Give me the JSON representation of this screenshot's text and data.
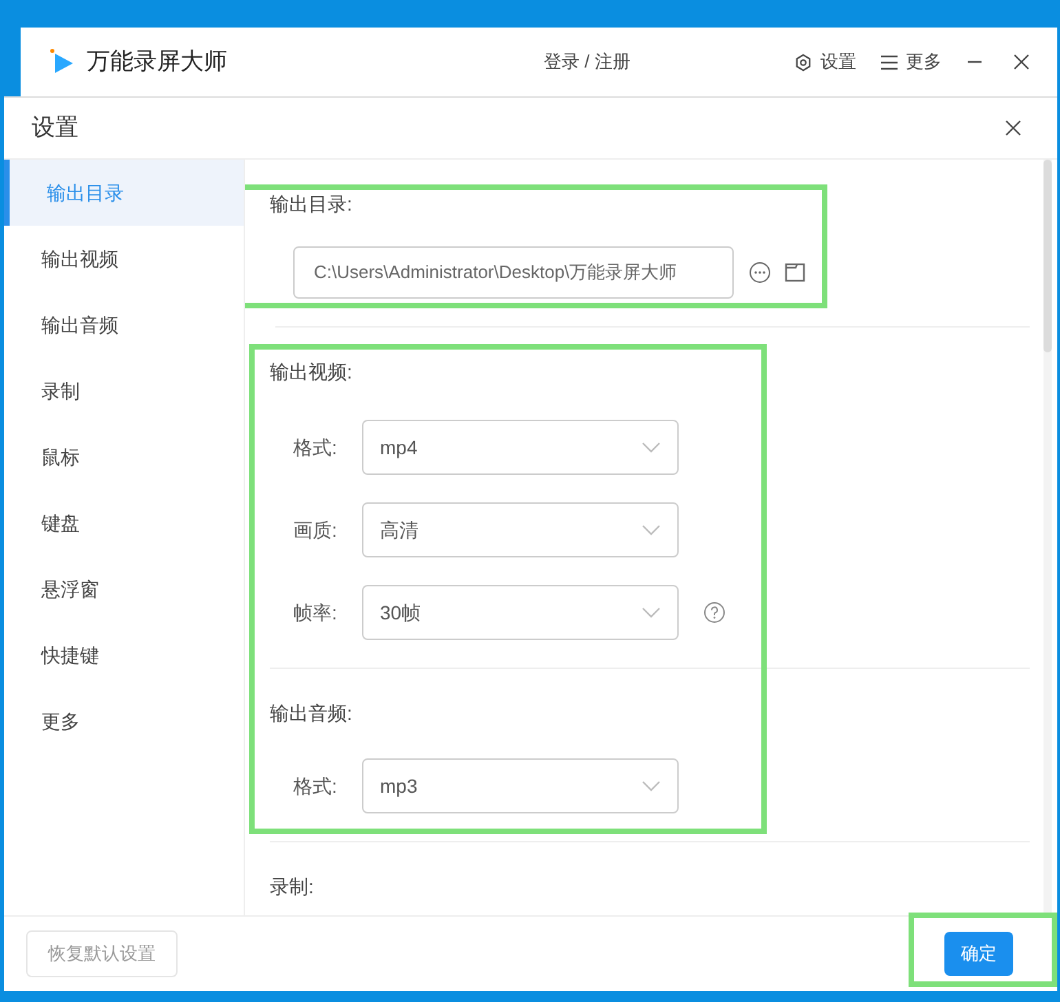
{
  "app": {
    "title": "万能录屏大师",
    "login": "登录 / 注册",
    "settings": "设置",
    "more": "更多"
  },
  "dialog": {
    "title": "设置"
  },
  "sidebar": {
    "items": [
      {
        "label": "输出目录",
        "selected": true
      },
      {
        "label": "输出视频",
        "selected": false
      },
      {
        "label": "输出音频",
        "selected": false
      },
      {
        "label": "录制",
        "selected": false
      },
      {
        "label": "鼠标",
        "selected": false
      },
      {
        "label": "键盘",
        "selected": false
      },
      {
        "label": "悬浮窗",
        "selected": false
      },
      {
        "label": "快捷键",
        "selected": false
      },
      {
        "label": "更多",
        "selected": false
      }
    ]
  },
  "output_dir": {
    "heading": "输出目录:",
    "value": "C:\\Users\\Administrator\\Desktop\\万能录屏大师"
  },
  "output_video": {
    "heading": "输出视频:",
    "fields": [
      {
        "label": "格式:",
        "value": "mp4",
        "help": false
      },
      {
        "label": "画质:",
        "value": "高清",
        "help": false
      },
      {
        "label": "帧率:",
        "value": "30帧",
        "help": true
      }
    ]
  },
  "output_audio": {
    "heading": "输出音频:",
    "fields": [
      {
        "label": "格式:",
        "value": "mp3",
        "help": false
      }
    ]
  },
  "recording": {
    "heading": "录制:"
  },
  "footer": {
    "reset": "恢复默认设置",
    "confirm": "确定"
  }
}
